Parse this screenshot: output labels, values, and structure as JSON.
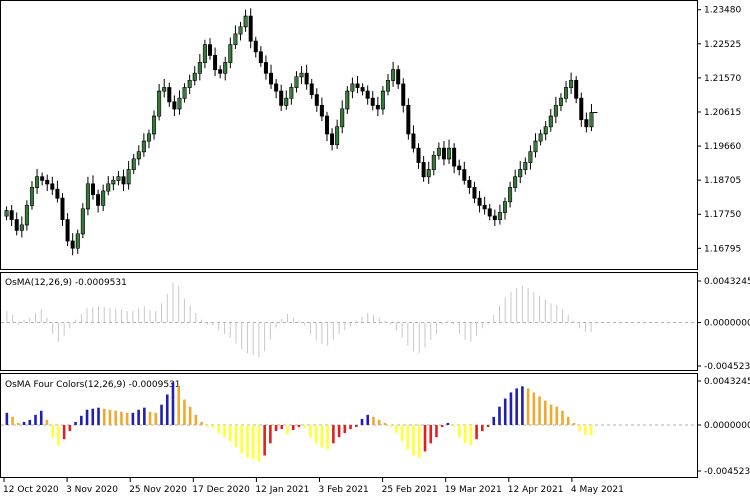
{
  "chart_data": [
    {
      "type": "candlestick",
      "panel": "price",
      "ylim": [
        1.163,
        1.2364
      ],
      "y_ticks": [
        "1.23480",
        "1.22525",
        "1.21570",
        "1.20615",
        "1.19660",
        "1.18705",
        "1.17750",
        "1.16795"
      ],
      "x_tick_labels": [
        "12 Oct 2020",
        "3 Nov 2020",
        "25 Nov 2020",
        "17 Dec 2020",
        "12 Jan 2021",
        "3 Feb 2021",
        "25 Feb 2021",
        "19 Mar 2021",
        "12 Apr 2021",
        "4 May 2021"
      ],
      "closes": [
        1.1785,
        1.176,
        1.173,
        1.1745,
        1.18,
        1.185,
        1.188,
        1.187,
        1.186,
        1.1845,
        1.182,
        1.176,
        1.17,
        1.168,
        1.172,
        1.179,
        1.186,
        1.183,
        1.18,
        1.184,
        1.186,
        1.187,
        1.188,
        1.186,
        1.19,
        1.193,
        1.195,
        1.198,
        1.2,
        1.205,
        1.212,
        1.213,
        1.209,
        1.207,
        1.21,
        1.213,
        1.215,
        1.217,
        1.22,
        1.225,
        1.222,
        1.218,
        1.217,
        1.22,
        1.225,
        1.228,
        1.23,
        1.233,
        1.226,
        1.223,
        1.22,
        1.217,
        1.214,
        1.212,
        1.208,
        1.21,
        1.213,
        1.216,
        1.217,
        1.214,
        1.211,
        1.208,
        1.205,
        1.2,
        1.197,
        1.202,
        1.207,
        1.212,
        1.214,
        1.213,
        1.212,
        1.21,
        1.208,
        1.207,
        1.212,
        1.215,
        1.218,
        1.214,
        1.208,
        1.2,
        1.196,
        1.192,
        1.188,
        1.19,
        1.194,
        1.196,
        1.193,
        1.196,
        1.191,
        1.19,
        1.187,
        1.185,
        1.182,
        1.18,
        1.179,
        1.177,
        1.176,
        1.178,
        1.181,
        1.185,
        1.188,
        1.19,
        1.192,
        1.195,
        1.198,
        1.2,
        1.202,
        1.205,
        1.208,
        1.21,
        1.213,
        1.215,
        1.21,
        1.204,
        1.202,
        1.206
      ]
    },
    {
      "type": "histogram",
      "panel": "osma",
      "title": "OsMA(12,26,9) -0.0009531",
      "ylim": [
        -0.0045234,
        0.0043245
      ],
      "y_ticks": [
        "0.0043245",
        "0.0000000",
        "-0.0045234"
      ],
      "zero_label": "0.0000000",
      "bar_color": "#c8c8c8",
      "values": [
        0.0012,
        0.0008,
        -0.0002,
        0.0003,
        0.0005,
        0.001,
        0.0014,
        0.0005,
        -0.0012,
        -0.002,
        -0.0014,
        -0.0006,
        0.0003,
        0.0009,
        0.0015,
        0.0016,
        0.0017,
        0.0016,
        0.0015,
        0.0014,
        0.0013,
        0.0012,
        0.0012,
        0.0015,
        0.0017,
        0.0013,
        0.0012,
        0.002,
        0.003,
        0.0042,
        0.0038,
        0.0025,
        0.0018,
        0.001,
        0.0003,
        -0.0002,
        -0.0003,
        -0.0008,
        -0.0012,
        -0.0016,
        -0.0022,
        -0.0028,
        -0.0032,
        -0.0034,
        -0.0036,
        -0.003,
        -0.0018,
        -0.0006,
        0.0004,
        0.0009,
        0.0005,
        0.0002,
        -0.0003,
        -0.0012,
        -0.0018,
        -0.0022,
        -0.0024,
        -0.0018,
        -0.0012,
        -0.0008,
        -0.0004,
        0.0002,
        0.0006,
        0.001,
        0.0008,
        0.0005,
        0.0002,
        -0.0002,
        -0.0008,
        -0.0016,
        -0.0024,
        -0.003,
        -0.0032,
        -0.0026,
        -0.0018,
        -0.0012,
        -0.0002,
        0.0002,
        -0.0002,
        -0.0012,
        -0.0018,
        -0.002,
        -0.0014,
        -0.0006,
        -0.0002,
        0.0008,
        0.0018,
        0.0026,
        0.0032,
        0.0036,
        0.0038,
        0.0036,
        0.0032,
        0.0028,
        0.0024,
        0.002,
        0.0018,
        0.0014,
        0.0008,
        0.0002,
        -0.0006,
        -0.001,
        -0.001
      ]
    },
    {
      "type": "histogram",
      "panel": "osma-four-colors",
      "title": "OsMA Four Colors(12,26,9) -0.0009531",
      "ylim": [
        -0.0045234,
        0.0043245
      ],
      "y_ticks": [
        "0.0043245",
        "0.0000000",
        "-0.0045234"
      ],
      "zero_label": "0.0000000",
      "colors": {
        "pos_up": "#1f1fb4",
        "pos_down": "#f0a830",
        "neg_down": "#ffff33",
        "neg_up": "#e0201f"
      },
      "values": [
        0.0012,
        0.0008,
        0.0002,
        0.0003,
        0.0005,
        0.001,
        0.0014,
        0.0005,
        -0.0012,
        -0.002,
        -0.0014,
        -0.0006,
        0.0003,
        0.0009,
        0.0015,
        0.0016,
        0.0017,
        0.0016,
        0.0015,
        0.0014,
        0.0013,
        0.0012,
        0.0012,
        0.0015,
        0.0017,
        0.0013,
        0.0012,
        0.002,
        0.003,
        0.0042,
        0.0038,
        0.0025,
        0.0018,
        0.001,
        0.0003,
        -0.0002,
        -0.0003,
        -0.0008,
        -0.0012,
        -0.0016,
        -0.0022,
        -0.0028,
        -0.0032,
        -0.0034,
        -0.0036,
        -0.003,
        -0.0018,
        -0.0006,
        -0.0004,
        -0.0009,
        -0.0005,
        -0.0002,
        -0.0003,
        -0.0012,
        -0.0018,
        -0.0022,
        -0.0024,
        -0.0018,
        -0.0012,
        -0.0008,
        -0.0004,
        -0.0002,
        0.0006,
        0.001,
        0.0008,
        0.0005,
        0.0002,
        -0.0002,
        -0.0008,
        -0.0016,
        -0.0024,
        -0.003,
        -0.0032,
        -0.0026,
        -0.0018,
        -0.0012,
        -0.0002,
        0.0002,
        -0.0002,
        -0.0012,
        -0.0018,
        -0.002,
        -0.0014,
        -0.0006,
        -0.0002,
        0.0008,
        0.0018,
        0.0026,
        0.0032,
        0.0036,
        0.0038,
        0.0036,
        0.0032,
        0.0028,
        0.0024,
        0.002,
        0.0018,
        0.0014,
        0.0008,
        0.0002,
        -0.0006,
        -0.001,
        -0.001
      ]
    }
  ]
}
